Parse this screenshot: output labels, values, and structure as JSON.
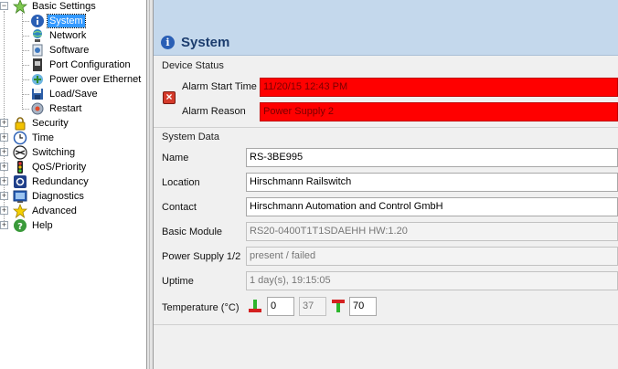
{
  "tree": {
    "root": "Basic Settings",
    "children": [
      "System",
      "Network",
      "Software",
      "Port Configuration",
      "Power over Ethernet",
      "Load/Save",
      "Restart"
    ],
    "selected": "System",
    "sections": [
      "Security",
      "Time",
      "Switching",
      "QoS/Priority",
      "Redundancy",
      "Diagnostics",
      "Advanced",
      "Help"
    ]
  },
  "page": {
    "title": "System"
  },
  "device_status": {
    "title": "Device Status",
    "alarm_start_label": "Alarm Start Time",
    "alarm_start_value": "11/20/15 12:43 PM",
    "alarm_reason_label": "Alarm Reason",
    "alarm_reason_value": "Power Supply 2"
  },
  "system_data": {
    "title": "System Data",
    "name_label": "Name",
    "name_value": "RS-3BE995",
    "location_label": "Location",
    "location_value": "Hirschmann Railswitch",
    "contact_label": "Contact",
    "contact_value": "Hirschmann Automation and Control GmbH",
    "module_label": "Basic Module",
    "module_value": "RS20-0400T1T1SDAEHH HW:1.20",
    "power_label": "Power Supply 1/2",
    "power_value": "present / failed",
    "uptime_label": "Uptime",
    "uptime_value": "1 day(s), 19:15:05",
    "temp_label": "Temperature (°C)",
    "temp_low": "0",
    "temp_current": "37",
    "temp_high": "70"
  },
  "colors": {
    "alarm": "#ff0000",
    "header_band": "#c4d8ec",
    "selection": "#3399ff"
  }
}
